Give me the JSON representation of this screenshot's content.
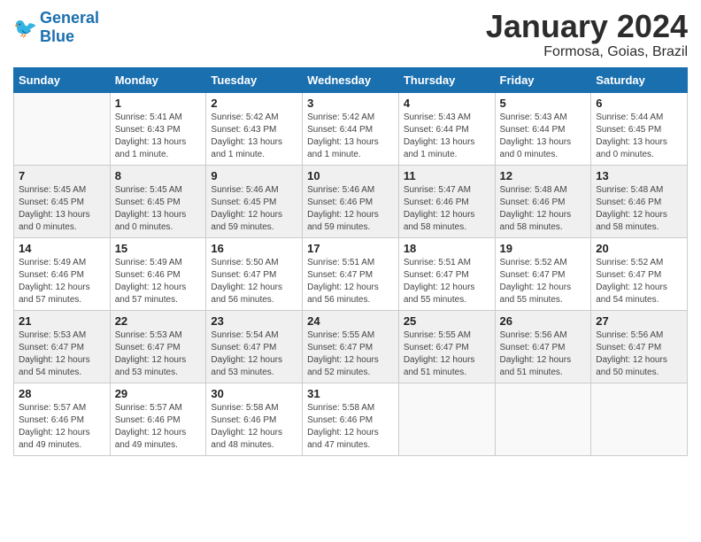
{
  "logo": {
    "line1": "General",
    "line2": "Blue"
  },
  "header": {
    "month": "January 2024",
    "location": "Formosa, Goias, Brazil"
  },
  "weekdays": [
    "Sunday",
    "Monday",
    "Tuesday",
    "Wednesday",
    "Thursday",
    "Friday",
    "Saturday"
  ],
  "weeks": [
    [
      {
        "day": "",
        "info": ""
      },
      {
        "day": "1",
        "info": "Sunrise: 5:41 AM\nSunset: 6:43 PM\nDaylight: 13 hours\nand 1 minute."
      },
      {
        "day": "2",
        "info": "Sunrise: 5:42 AM\nSunset: 6:43 PM\nDaylight: 13 hours\nand 1 minute."
      },
      {
        "day": "3",
        "info": "Sunrise: 5:42 AM\nSunset: 6:44 PM\nDaylight: 13 hours\nand 1 minute."
      },
      {
        "day": "4",
        "info": "Sunrise: 5:43 AM\nSunset: 6:44 PM\nDaylight: 13 hours\nand 1 minute."
      },
      {
        "day": "5",
        "info": "Sunrise: 5:43 AM\nSunset: 6:44 PM\nDaylight: 13 hours\nand 0 minutes."
      },
      {
        "day": "6",
        "info": "Sunrise: 5:44 AM\nSunset: 6:45 PM\nDaylight: 13 hours\nand 0 minutes."
      }
    ],
    [
      {
        "day": "7",
        "info": "Sunrise: 5:45 AM\nSunset: 6:45 PM\nDaylight: 13 hours\nand 0 minutes."
      },
      {
        "day": "8",
        "info": "Sunrise: 5:45 AM\nSunset: 6:45 PM\nDaylight: 13 hours\nand 0 minutes."
      },
      {
        "day": "9",
        "info": "Sunrise: 5:46 AM\nSunset: 6:45 PM\nDaylight: 12 hours\nand 59 minutes."
      },
      {
        "day": "10",
        "info": "Sunrise: 5:46 AM\nSunset: 6:46 PM\nDaylight: 12 hours\nand 59 minutes."
      },
      {
        "day": "11",
        "info": "Sunrise: 5:47 AM\nSunset: 6:46 PM\nDaylight: 12 hours\nand 58 minutes."
      },
      {
        "day": "12",
        "info": "Sunrise: 5:48 AM\nSunset: 6:46 PM\nDaylight: 12 hours\nand 58 minutes."
      },
      {
        "day": "13",
        "info": "Sunrise: 5:48 AM\nSunset: 6:46 PM\nDaylight: 12 hours\nand 58 minutes."
      }
    ],
    [
      {
        "day": "14",
        "info": "Sunrise: 5:49 AM\nSunset: 6:46 PM\nDaylight: 12 hours\nand 57 minutes."
      },
      {
        "day": "15",
        "info": "Sunrise: 5:49 AM\nSunset: 6:46 PM\nDaylight: 12 hours\nand 57 minutes."
      },
      {
        "day": "16",
        "info": "Sunrise: 5:50 AM\nSunset: 6:47 PM\nDaylight: 12 hours\nand 56 minutes."
      },
      {
        "day": "17",
        "info": "Sunrise: 5:51 AM\nSunset: 6:47 PM\nDaylight: 12 hours\nand 56 minutes."
      },
      {
        "day": "18",
        "info": "Sunrise: 5:51 AM\nSunset: 6:47 PM\nDaylight: 12 hours\nand 55 minutes."
      },
      {
        "day": "19",
        "info": "Sunrise: 5:52 AM\nSunset: 6:47 PM\nDaylight: 12 hours\nand 55 minutes."
      },
      {
        "day": "20",
        "info": "Sunrise: 5:52 AM\nSunset: 6:47 PM\nDaylight: 12 hours\nand 54 minutes."
      }
    ],
    [
      {
        "day": "21",
        "info": "Sunrise: 5:53 AM\nSunset: 6:47 PM\nDaylight: 12 hours\nand 54 minutes."
      },
      {
        "day": "22",
        "info": "Sunrise: 5:53 AM\nSunset: 6:47 PM\nDaylight: 12 hours\nand 53 minutes."
      },
      {
        "day": "23",
        "info": "Sunrise: 5:54 AM\nSunset: 6:47 PM\nDaylight: 12 hours\nand 53 minutes."
      },
      {
        "day": "24",
        "info": "Sunrise: 5:55 AM\nSunset: 6:47 PM\nDaylight: 12 hours\nand 52 minutes."
      },
      {
        "day": "25",
        "info": "Sunrise: 5:55 AM\nSunset: 6:47 PM\nDaylight: 12 hours\nand 51 minutes."
      },
      {
        "day": "26",
        "info": "Sunrise: 5:56 AM\nSunset: 6:47 PM\nDaylight: 12 hours\nand 51 minutes."
      },
      {
        "day": "27",
        "info": "Sunrise: 5:56 AM\nSunset: 6:47 PM\nDaylight: 12 hours\nand 50 minutes."
      }
    ],
    [
      {
        "day": "28",
        "info": "Sunrise: 5:57 AM\nSunset: 6:46 PM\nDaylight: 12 hours\nand 49 minutes."
      },
      {
        "day": "29",
        "info": "Sunrise: 5:57 AM\nSunset: 6:46 PM\nDaylight: 12 hours\nand 49 minutes."
      },
      {
        "day": "30",
        "info": "Sunrise: 5:58 AM\nSunset: 6:46 PM\nDaylight: 12 hours\nand 48 minutes."
      },
      {
        "day": "31",
        "info": "Sunrise: 5:58 AM\nSunset: 6:46 PM\nDaylight: 12 hours\nand 47 minutes."
      },
      {
        "day": "",
        "info": ""
      },
      {
        "day": "",
        "info": ""
      },
      {
        "day": "",
        "info": ""
      }
    ]
  ]
}
